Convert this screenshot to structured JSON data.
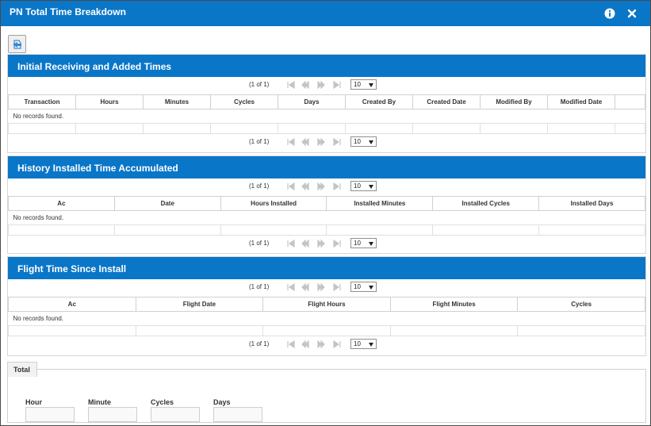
{
  "dialog": {
    "title": "PN Total Time Breakdown",
    "icons": {
      "info": "info-icon",
      "close": "close-icon",
      "export": "export-icon"
    }
  },
  "paginator": {
    "page_info": "(1 of 1)",
    "rows_per_page": "10"
  },
  "sections": {
    "initial_receiving": {
      "title": "Initial Receiving and Added Times",
      "columns": [
        "Transaction",
        "Hours",
        "Minutes",
        "Cycles",
        "Days",
        "Created By",
        "Created Date",
        "Modified By",
        "Modified Date"
      ],
      "empty_message": "No records found."
    },
    "history_installed": {
      "title": "History Installed Time Accumulated",
      "columns": [
        "Ac",
        "Date",
        "Hours Installed",
        "Installed Minutes",
        "Installed Cycles",
        "Installed Days"
      ],
      "empty_message": "No records found."
    },
    "flight_time": {
      "title": "Flight Time Since Install",
      "columns": [
        "Ac",
        "Flight Date",
        "Flight Hours",
        "Flight Minutes",
        "Cycles"
      ],
      "empty_message": "No records found."
    }
  },
  "total": {
    "legend": "Total",
    "fields": [
      {
        "label": "Hour",
        "value": ""
      },
      {
        "label": "Minute",
        "value": ""
      },
      {
        "label": "Cycles",
        "value": ""
      },
      {
        "label": "Days",
        "value": ""
      }
    ]
  },
  "colors": {
    "header_blue": "#0a76c8",
    "border": "#d0d0d0"
  }
}
